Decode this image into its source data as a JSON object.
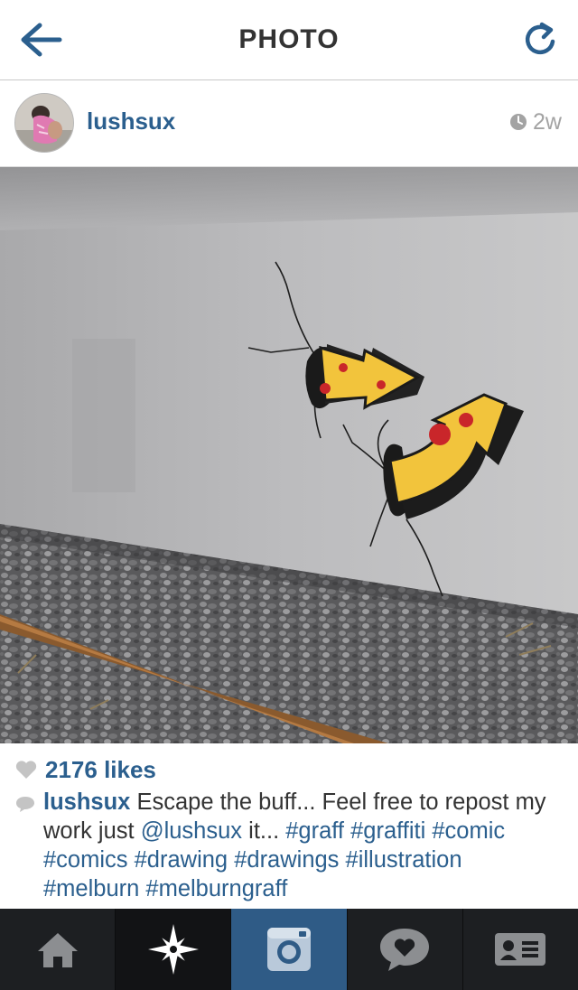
{
  "header": {
    "title": "PHOTO",
    "back_icon": "back-arrow-icon",
    "refresh_icon": "refresh-icon",
    "accent_color": "#2b5f8e"
  },
  "post": {
    "username": "lushsux",
    "time": "2w",
    "likes": "2176 likes",
    "caption": {
      "username": "lushsux",
      "text1": " Escape the buff... Feel free to repost my work just ",
      "mention": "@lushsux",
      "text2": " it... ",
      "tags": [
        "#graff",
        "#graffiti",
        "#comic",
        "#comics",
        "#drawing",
        "#drawings",
        "#illustration",
        "#melburn",
        "#melburngraff"
      ]
    }
  },
  "tabbar": {
    "tabs": [
      {
        "name": "home",
        "icon": "home-icon"
      },
      {
        "name": "explore",
        "icon": "compass-star-icon"
      },
      {
        "name": "camera",
        "icon": "camera-icon",
        "active": true
      },
      {
        "name": "activity",
        "icon": "heart-bubble-icon"
      },
      {
        "name": "profile",
        "icon": "profile-card-icon"
      }
    ]
  }
}
